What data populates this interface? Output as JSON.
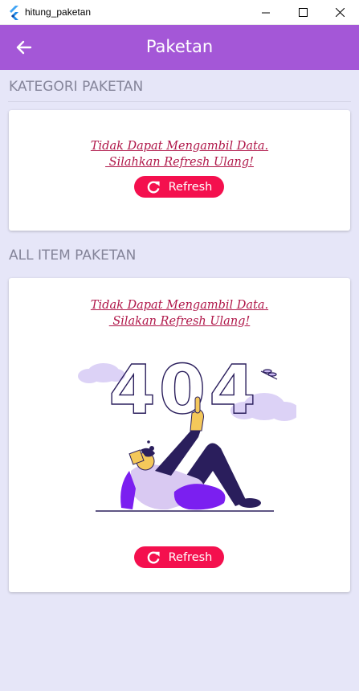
{
  "window": {
    "title": "hitung_paketan",
    "minimize_icon": "minimize-icon",
    "maximize_icon": "maximize-icon",
    "close_icon": "close-icon"
  },
  "appbar": {
    "title": "Paketan",
    "back_icon": "arrow-left-icon",
    "color": "#A457D7"
  },
  "sections": {
    "kategori": {
      "title": "KATEGORI PAKETAN",
      "error_line1": "Tidak Dapat Mengambil Data.",
      "error_line2": " Silahkan Refresh Ulang!",
      "button_label": "Refresh"
    },
    "all_item": {
      "title": "ALL ITEM PAKETAN",
      "error_line1": "Tidak Dapat Mengambil Data.",
      "error_line2": " Silakan Refresh Ulang!",
      "illustration_text": "404",
      "button_label": "Refresh"
    }
  },
  "colors": {
    "background": "#E6E6F8",
    "accent_button": "#F4104E",
    "error_text": "#B0184A",
    "section_title": "#85859A"
  }
}
